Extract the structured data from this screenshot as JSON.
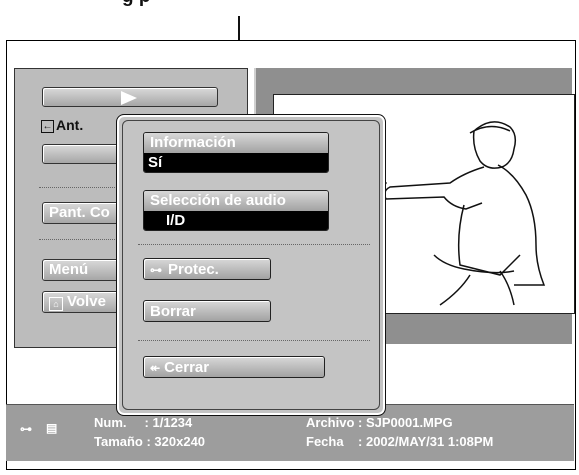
{
  "callout": {
    "label": "g    p"
  },
  "left_menu": {
    "prev_label": "Ant.",
    "pant_label": "Pant. Co",
    "menu_label": "Menú",
    "volver_label": "Volve"
  },
  "popup": {
    "info_label": "Información",
    "info_value": "Sí",
    "audio_label": "Selección de audio",
    "audio_value": "I/D",
    "protect_label": "Protec.",
    "delete_label": "Borrar",
    "close_label": "Cerrar"
  },
  "status": {
    "num": "Num.     : 1/1234",
    "size": "Tamaño : 320x240",
    "file": "Archivo : SJP0001.MPG",
    "date": "Fecha    : 2002/MAY/31 1:08PM"
  },
  "icons": {
    "key": "key-icon",
    "memory": "memory-card-icon",
    "play": "play-icon",
    "pause": "pause-icon",
    "stop": "stop-icon",
    "rewind": "rewind-icon",
    "forward": "fast-forward-icon"
  }
}
